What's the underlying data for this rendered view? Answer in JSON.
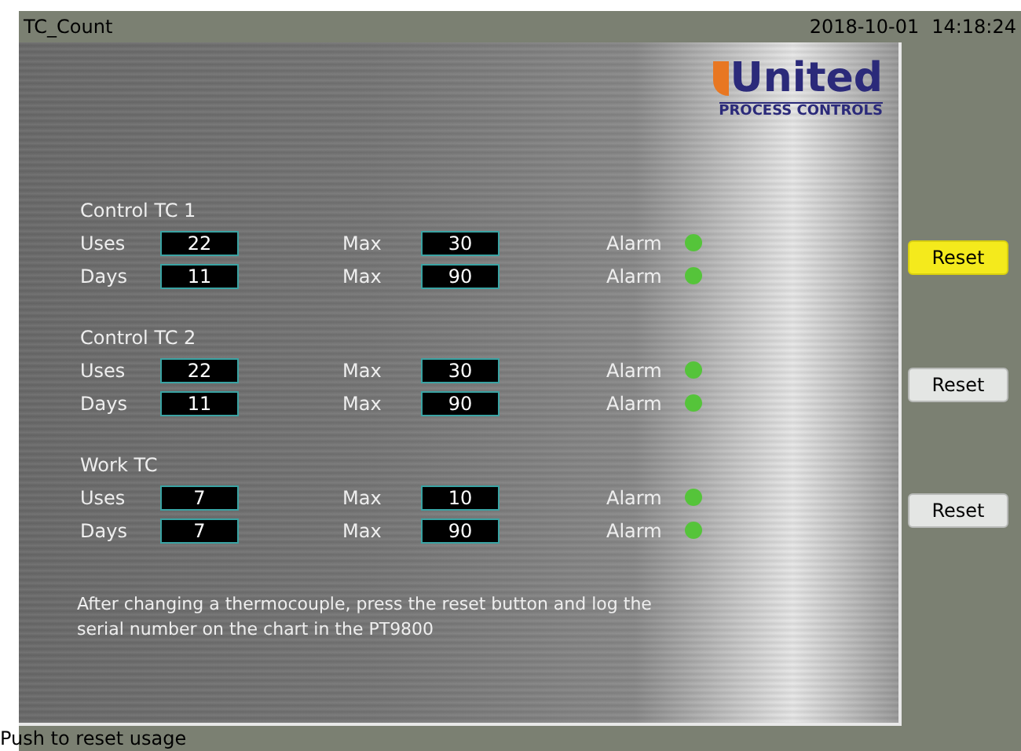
{
  "title_bar": {
    "title": "TC_Count",
    "date": "2018-10-01",
    "time": "14:18:24"
  },
  "logo": {
    "name": "United",
    "tagline": "PROCESS CONTROLS"
  },
  "groups": [
    {
      "title": "Control TC 1",
      "rows": [
        {
          "label": "Uses",
          "value": "22",
          "max_label": "Max",
          "max": "30",
          "alarm_label": "Alarm",
          "alarm": false
        },
        {
          "label": "Days",
          "value": "11",
          "max_label": "Max",
          "max": "90",
          "alarm_label": "Alarm",
          "alarm": false
        }
      ],
      "reset": {
        "label": "Reset",
        "selected": true
      }
    },
    {
      "title": "Control TC 2",
      "rows": [
        {
          "label": "Uses",
          "value": "22",
          "max_label": "Max",
          "max": "30",
          "alarm_label": "Alarm",
          "alarm": false
        },
        {
          "label": "Days",
          "value": "11",
          "max_label": "Max",
          "max": "90",
          "alarm_label": "Alarm",
          "alarm": false
        }
      ],
      "reset": {
        "label": "Reset",
        "selected": false
      }
    },
    {
      "title": "Work TC",
      "rows": [
        {
          "label": "Uses",
          "value": "7",
          "max_label": "Max",
          "max": "10",
          "alarm_label": "Alarm",
          "alarm": false
        },
        {
          "label": "Days",
          "value": "7",
          "max_label": "Max",
          "max": "90",
          "alarm_label": "Alarm",
          "alarm": false
        }
      ],
      "reset": {
        "label": "Reset",
        "selected": false
      }
    }
  ],
  "note": "After changing a thermocouple, press the reset button and log the serial number on the chart in the PT9800",
  "status_bar": "Push to reset usage"
}
